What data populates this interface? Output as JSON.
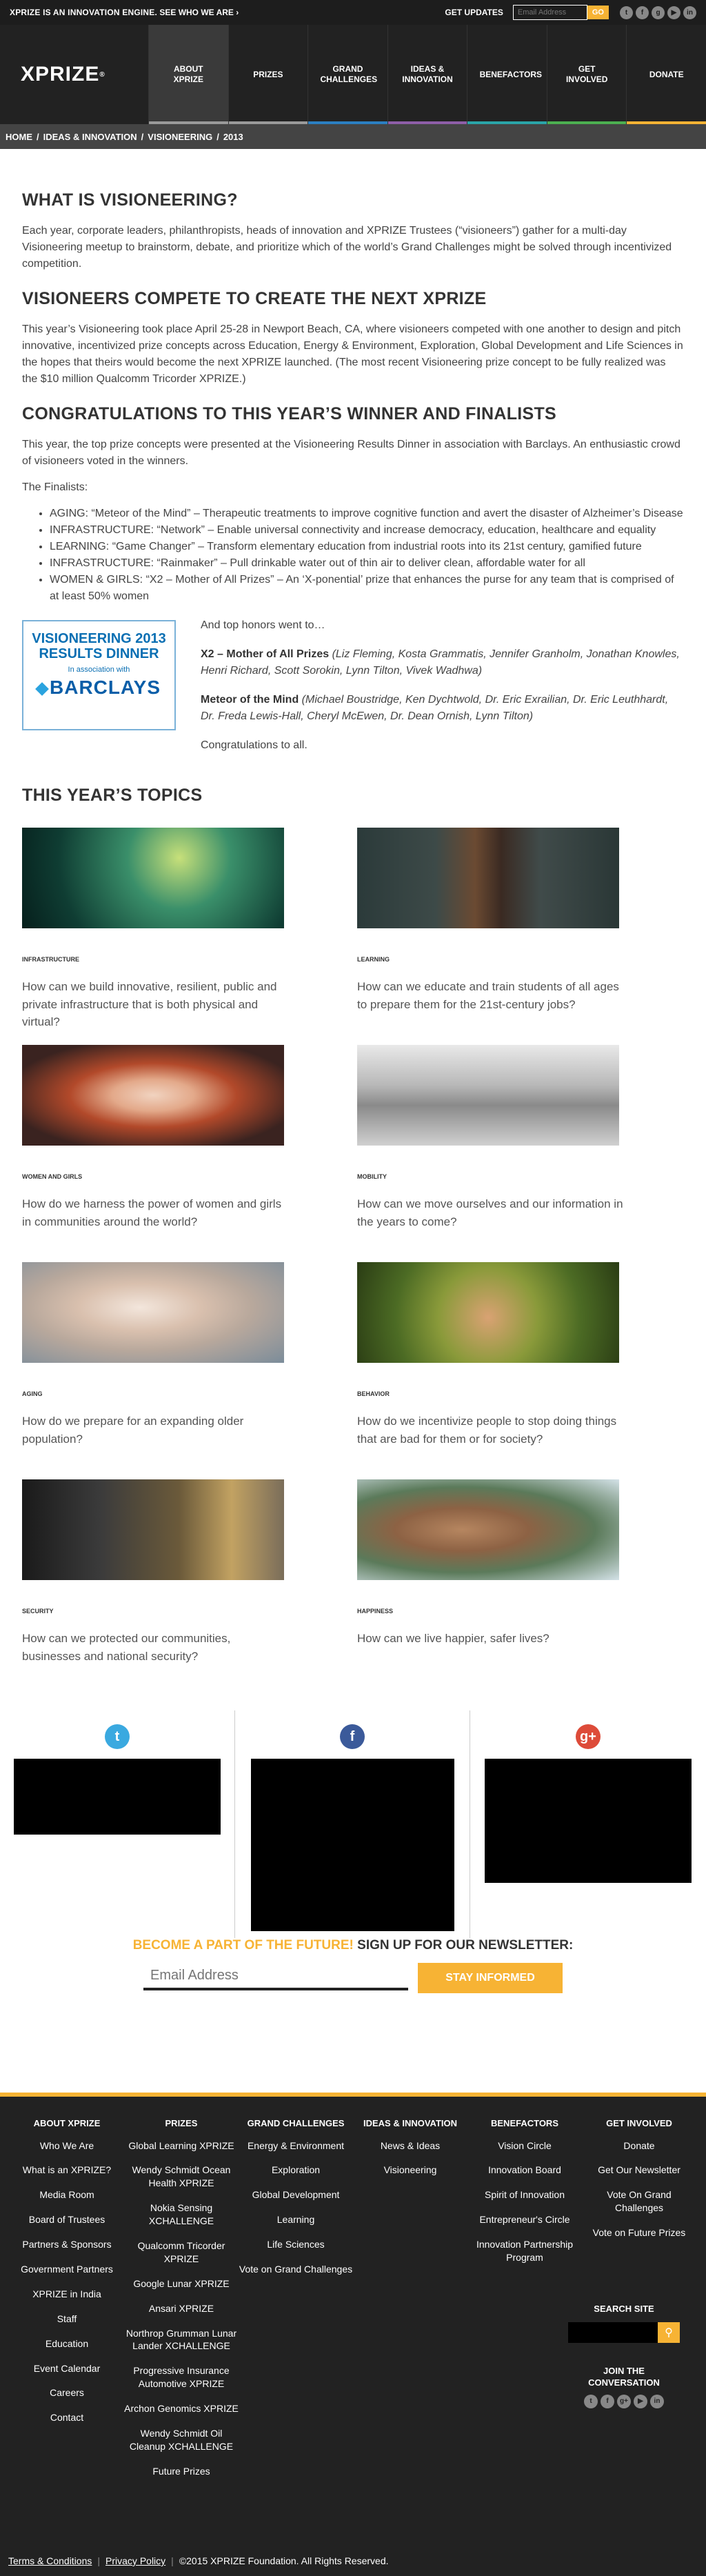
{
  "topbar": {
    "promo": "XPRIZE IS AN INNOVATION ENGINE.",
    "promo_link": "SEE WHO WE ARE ›",
    "updates_label": "GET UPDATES",
    "email_placeholder": "Email Address",
    "go_label": "GO",
    "social_icons": [
      "twitter-icon",
      "facebook-icon",
      "google-plus-icon",
      "youtube-icon",
      "linkedin-icon"
    ]
  },
  "logo": {
    "text": "XPRIZE",
    "mark": "®"
  },
  "nav": [
    {
      "label": "ABOUT XPRIZE",
      "color": "#9a9a9a",
      "active": true
    },
    {
      "label": "PRIZES",
      "color": "#9a9a9a"
    },
    {
      "label": "GRAND CHALLENGES",
      "color": "#2b7fc1"
    },
    {
      "label": "IDEAS & INNOVATION",
      "color": "#8e5ea8"
    },
    {
      "label": "BENEFACTORS",
      "color": "#2aa4a8"
    },
    {
      "label": "GET INVOLVED",
      "color": "#4caf50"
    },
    {
      "label": "DONATE",
      "color": "#f7b334"
    }
  ],
  "breadcrumbs": [
    "HOME",
    "/",
    "IDEAS & INNOVATION",
    "/",
    "VISIONEERING",
    "/",
    "2013"
  ],
  "sections": {
    "s1_title": "WHAT IS VISIONEERING?",
    "s1_body": "Each year, corporate leaders, philanthropists, heads of innovation and XPRIZE Trustees (“visioneers”) gather for a multi-day Visioneering meetup to brainstorm, debate, and prioritize which of the world’s Grand Challenges might be solved through incentivized competition.",
    "s2_title": "VISIONEERS COMPETE TO CREATE THE NEXT XPRIZE",
    "s2_body": "This year’s Visioneering took place April 25-28 in Newport Beach, CA, where visioneers competed with one another to design and pitch innovative, incentivized prize concepts across Education, Energy & Environment, Exploration, Global Development and Life Sciences in the hopes that theirs would become the next XPRIZE launched. (The most recent Visioneering prize concept to be fully realized was the $10 million Qualcomm Tricorder XPRIZE.)",
    "s3_title": "CONGRATULATIONS TO THIS YEAR’S WINNER AND FINALISTS",
    "s3_body": "This year, the top prize concepts were presented at the Visioneering Results Dinner in association with Barclays. An enthusiastic crowd of visioneers voted in the winners.",
    "finalists_label": "The Finalists:",
    "finalists": [
      "AGING: “Meteor of the Mind” – Therapeutic treatments to improve cognitive function and avert the disaster of Alzheimer’s Disease",
      "INFRASTRUCTURE: “Network” – Enable universal connectivity and increase democracy, education, healthcare and equality",
      "LEARNING: “Game Changer” – Transform elementary education from industrial roots into its 21st century, gamified future",
      "INFRASTRUCTURE: “Rainmaker” – Pull drinkable water out of thin air to deliver clean, affordable water for all",
      "WOMEN & GIRLS: “X2 – Mother of All Prizes” – An ‘X-ponential’ prize that enhances the purse for any team that is comprised of at least 50% women"
    ],
    "badge": {
      "line1": "VISIONEERING 2013",
      "line2": "RESULTS DINNER",
      "line3": "In association with",
      "line4": "BARCLAYS"
    },
    "honors_intro": "And top honors went to…",
    "winner1_title": "X2 – Mother of All Prizes",
    "winner1_names": "(Liz Fleming, Kosta Grammatis, Jennifer Granholm, Jonathan Knowles, Henri Richard, Scott Sorokin, Lynn Tilton, Vivek Wadhwa)",
    "winner2_title": "Meteor of the Mind",
    "winner2_names": "(Michael Boustridge, Ken Dychtwold, Dr. Eric Exrailian, Dr. Eric Leuthhardt, Dr. Freda Lewis-Hall, Cheryl McEwen, Dr. Dean Ornish, Lynn Tilton)",
    "congrats": "Congratulations to all.",
    "topics_title": "THIS YEAR’S TOPICS"
  },
  "topics": [
    {
      "category": "INFRASTRUCTURE",
      "question": "How can we build innovative, resilient, public and private infrastructure that is both physical and virtual?",
      "image": "circuit-board-image"
    },
    {
      "category": "LEARNING",
      "question": "How can we educate and train students of all ages to prepare them for the 21st-century jobs?",
      "image": "child-chalkboard-image"
    },
    {
      "category": "WOMEN AND GIRLS",
      "question": "How do we harness the power of women and girls in communities around the world?",
      "image": "woman-portrait-image"
    },
    {
      "category": "MOBILITY",
      "question": "How can we move ourselves and our information in the years to come?",
      "image": "airport-security-image"
    },
    {
      "category": "AGING",
      "question": "How do we prepare for an expanding older population?",
      "image": "elderly-woman-image"
    },
    {
      "category": "BEHAVIOR",
      "question": "How do we incentivize people to stop doing things that are bad for them or for society?",
      "image": "meditation-hand-image"
    },
    {
      "category": "SECURITY",
      "question": "How can we protected our communities, businesses and national security?",
      "image": "security-officer-image"
    },
    {
      "category": "HAPPINESS",
      "question": "How can we live happier, safer lives?",
      "image": "smiling-man-image"
    }
  ],
  "social": [
    {
      "name": "twitter",
      "glyph": "t",
      "color": "#3aa9e0"
    },
    {
      "name": "facebook",
      "glyph": "f",
      "color": "#3b5a9a"
    },
    {
      "name": "google-plus",
      "glyph": "g+",
      "color": "#dd4b39"
    }
  ],
  "newsletter": {
    "accent": "BECOME A PART OF THE FUTURE!",
    "text": "SIGN UP FOR OUR NEWSLETTER:",
    "placeholder": "Email Address",
    "button": "STAY INFORMED"
  },
  "footer": {
    "columns": [
      {
        "title": "ABOUT XPRIZE",
        "items": [
          "Who We Are",
          "What is an XPRIZE?",
          "Media Room",
          "Board of Trustees",
          "Partners & Sponsors",
          "Government Partners",
          "XPRIZE in India",
          "Staff",
          "Education",
          "Event Calendar",
          "Careers",
          "Contact"
        ]
      },
      {
        "title": "PRIZES",
        "items": [
          "Global Learning XPRIZE",
          "Wendy Schmidt Ocean Health XPRIZE",
          "Nokia Sensing XCHALLENGE",
          "Qualcomm Tricorder XPRIZE",
          "Google Lunar XPRIZE",
          "Ansari XPRIZE",
          "Northrop Grumman Lunar Lander XCHALLENGE",
          "Progressive Insurance Automotive XPRIZE",
          "Archon Genomics XPRIZE",
          "Wendy Schmidt Oil Cleanup XCHALLENGE",
          "Future Prizes"
        ]
      },
      {
        "title": "GRAND CHALLENGES",
        "items": [
          "Energy & Environment",
          "Exploration",
          "Global Development",
          "Learning",
          "Life Sciences",
          "Vote on Grand Challenges"
        ]
      },
      {
        "title": "IDEAS & INNOVATION",
        "items": [
          "News & Ideas",
          "Visioneering"
        ]
      },
      {
        "title": "BENEFACTORS",
        "items": [
          "Vision Circle",
          "Innovation Board",
          "Spirit of Innovation",
          "Entrepreneur's Circle",
          "Innovation Partnership Program"
        ]
      },
      {
        "title": "GET INVOLVED",
        "items": [
          "Donate",
          "Get Our Newsletter",
          "Vote On Grand Challenges",
          "Vote on Future Prizes"
        ]
      }
    ],
    "search_title": "SEARCH SITE",
    "join_title": "JOIN THE CONVERSATION",
    "join_icons": [
      "t",
      "f",
      "g+",
      "▶",
      "in"
    ],
    "terms": "Terms & Conditions",
    "privacy": "Privacy Policy",
    "copyright": "©2015 XPRIZE Foundation. All Rights Reserved."
  }
}
